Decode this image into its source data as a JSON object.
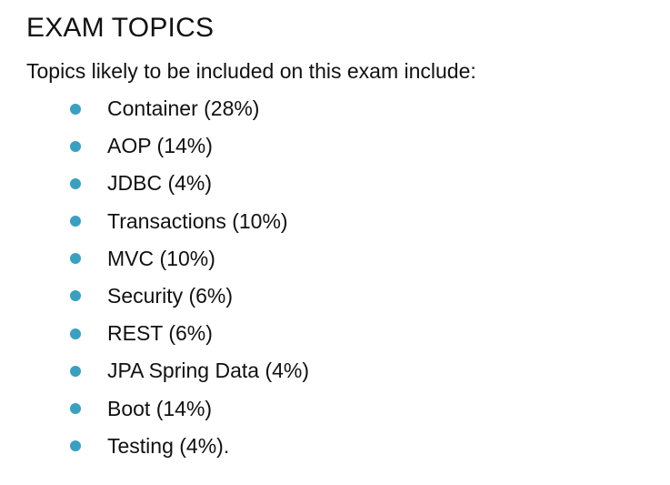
{
  "heading": "EXAM TOPICS",
  "intro": "Topics likely to be included on this exam include:",
  "bullet_color": "#3aa0c0",
  "topics": [
    "Container (28%)",
    "AOP (14%)",
    "JDBC (4%)",
    "Transactions (10%)",
    "MVC (10%)",
    "Security (6%)",
    "REST (6%)",
    "JPA Spring Data (4%)",
    "Boot (14%)",
    "Testing (4%)."
  ]
}
